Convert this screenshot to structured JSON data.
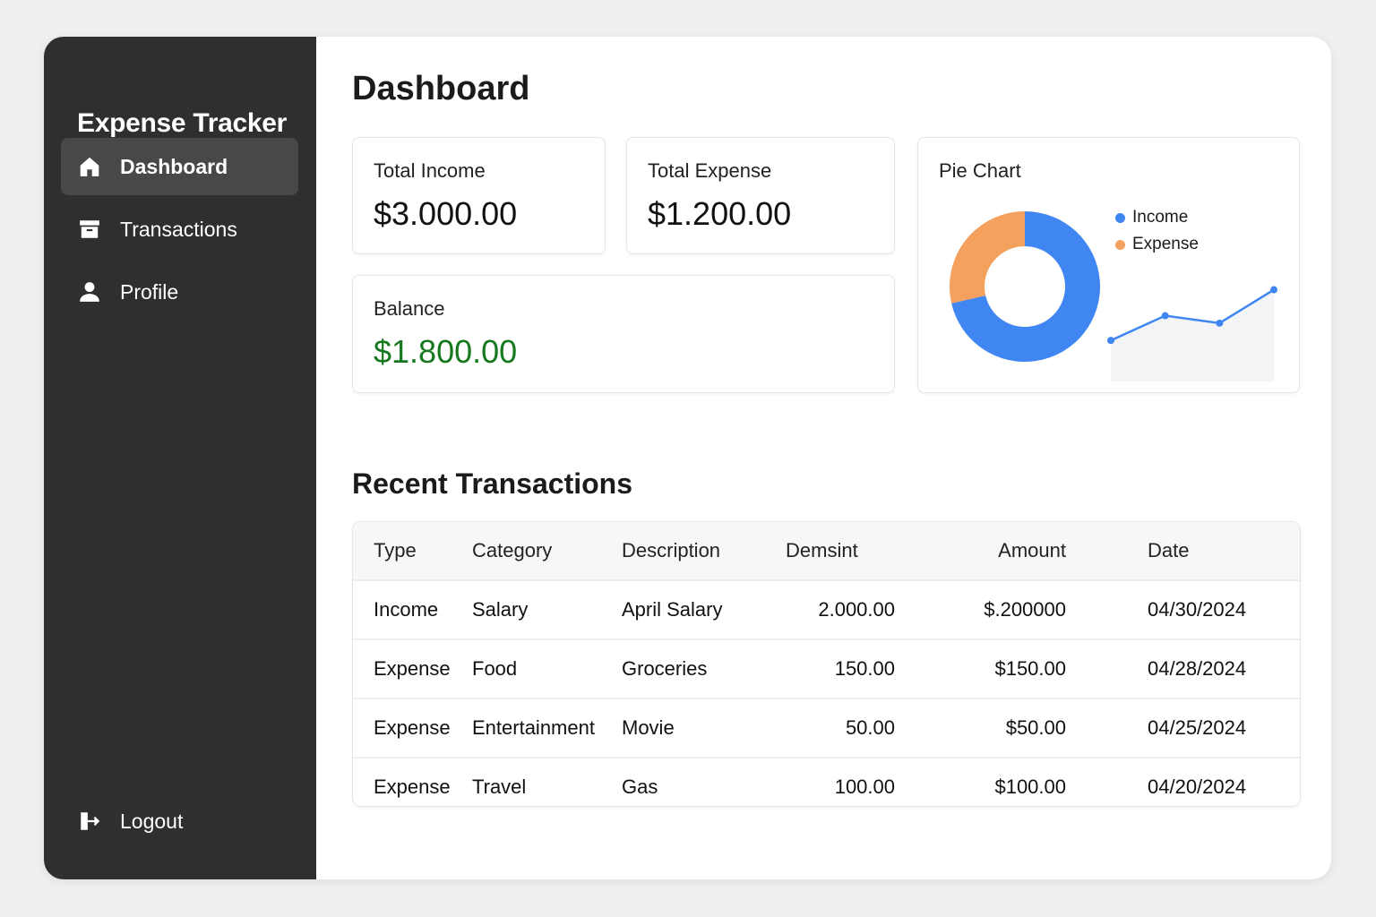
{
  "app": {
    "title": "Expense Tracker"
  },
  "sidebar": {
    "items": [
      {
        "label": "Dashboard",
        "icon": "home-icon",
        "active": true
      },
      {
        "label": "Transactions",
        "icon": "archive-icon",
        "active": false
      },
      {
        "label": "Profile",
        "icon": "user-icon",
        "active": false
      }
    ],
    "logout": {
      "label": "Logout",
      "icon": "logout-icon"
    }
  },
  "main": {
    "title": "Dashboard",
    "cards": {
      "income": {
        "label": "Total Income",
        "value": "$3.000.00"
      },
      "expense": {
        "label": "Total Expense",
        "value": "$1.200.00"
      },
      "balance": {
        "label": "Balance",
        "value": "$1.800.00"
      }
    },
    "pie_card": {
      "title": "Pie Chart",
      "legend": [
        {
          "label": "Income",
          "color": "#3f86f3"
        },
        {
          "label": "Expense",
          "color": "#f4a15d"
        }
      ]
    },
    "transactions": {
      "title": "Recent Transactions",
      "headers": [
        "Type",
        "Category",
        "Description",
        "Demsint",
        "Amount",
        "Date"
      ],
      "rows": [
        [
          "Income",
          "Salary",
          "April Salary",
          "2.000.00",
          "$.200000",
          "04/30/2024"
        ],
        [
          "Expense",
          "Food",
          "Groceries",
          "150.00",
          "$150.00",
          "04/28/2024"
        ],
        [
          "Expense",
          "Entertainment",
          "Movie",
          "50.00",
          "$50.00",
          "04/25/2024"
        ],
        [
          "Expense",
          "Travel",
          "Gas",
          "100.00",
          "$100.00",
          "04/20/2024"
        ]
      ]
    }
  },
  "colors": {
    "sidebar_bg": "#2f2f2f",
    "active_item_bg": "#484848",
    "balance_green": "#16781f",
    "income_blue": "#3f86f3",
    "expense_orange": "#f4a15d"
  },
  "chart_data": [
    {
      "type": "pie",
      "labels": [
        "Income",
        "Expense"
      ],
      "values": [
        3000,
        1200
      ],
      "title": "Pie Chart"
    },
    {
      "type": "line",
      "x": [
        1,
        2,
        3,
        4
      ],
      "values": [
        1,
        3,
        2.4,
        5.1
      ]
    }
  ]
}
